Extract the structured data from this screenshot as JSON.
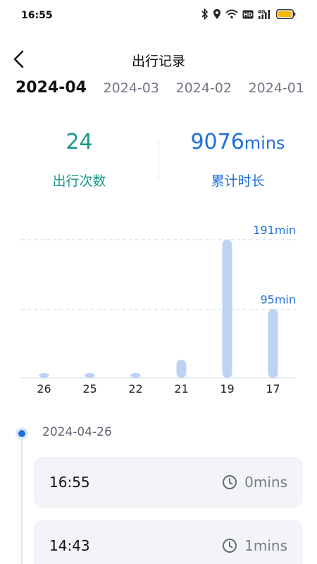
{
  "status_bar": {
    "time": "16:55",
    "icons": [
      "bluetooth-icon",
      "location-icon",
      "wifi-icon",
      "hd-icon",
      "signal-4g-icon",
      "battery-icon"
    ],
    "hd_text": "HD",
    "network_text": "4G",
    "battery_color": "#f5b800"
  },
  "header": {
    "title": "出行记录",
    "back_icon": "chevron-left-icon"
  },
  "month_tabs": [
    {
      "label": "2024-04",
      "active": true
    },
    {
      "label": "2024-03",
      "active": false
    },
    {
      "label": "2024-02",
      "active": false
    },
    {
      "label": "2024-01",
      "active": false
    }
  ],
  "stats": {
    "trip_count": {
      "value": "24",
      "label": "出行次数",
      "color": "#1a9a8a"
    },
    "total_duration": {
      "value": "9076",
      "unit": "mins",
      "label": "累计时长",
      "color": "#1f6fdb"
    }
  },
  "chart_data": {
    "type": "bar",
    "categories": [
      "26",
      "25",
      "22",
      "21",
      "19",
      "17"
    ],
    "values": [
      1,
      1,
      1,
      25,
      191,
      95
    ],
    "reference_lines": [
      {
        "value": 191,
        "label": "191min"
      },
      {
        "value": 95,
        "label": "95min"
      }
    ],
    "ylim": [
      0,
      191
    ],
    "bar_color": "#bcd3f4",
    "label_color": "#1f6fdb",
    "grid": false
  },
  "timeline": {
    "date": "2024-04-26",
    "trips": [
      {
        "time": "16:55",
        "duration": "0mins"
      },
      {
        "time": "14:43",
        "duration": "1mins"
      }
    ]
  }
}
